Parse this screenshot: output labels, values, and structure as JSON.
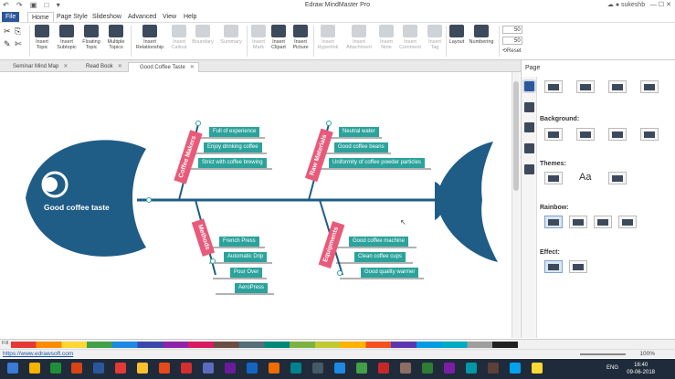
{
  "window": {
    "title": "Edraw MindMaster Pro",
    "user": "sukeshb",
    "quick_access": "↶ ↷ ▣ □ ▾"
  },
  "menu": {
    "file": "File",
    "items": [
      "Home",
      "Page Style",
      "Slideshow",
      "Advanced",
      "View",
      "Help"
    ]
  },
  "ribbon": {
    "buttons": [
      {
        "label": "Insert Topic",
        "enabled": true
      },
      {
        "label": "Insert Subtopic",
        "enabled": true
      },
      {
        "label": "Floating Topic",
        "enabled": true
      },
      {
        "label": "Multiple Topics",
        "enabled": true
      },
      {
        "label": "Insert Relationship",
        "enabled": true
      },
      {
        "label": "Insert Callout",
        "enabled": false
      },
      {
        "label": "Boundary",
        "enabled": false
      },
      {
        "label": "Summary",
        "enabled": false
      },
      {
        "label": "Insert Mark",
        "enabled": false
      },
      {
        "label": "Insert Clipart",
        "enabled": true
      },
      {
        "label": "Insert Picture",
        "enabled": true
      },
      {
        "label": "Insert Hyperlink",
        "enabled": false
      },
      {
        "label": "Insert Attachment",
        "enabled": false
      },
      {
        "label": "Insert Note",
        "enabled": false
      },
      {
        "label": "Insert Comment",
        "enabled": false
      },
      {
        "label": "Insert Tag",
        "enabled": false
      },
      {
        "label": "Layout",
        "enabled": true
      },
      {
        "label": "Numbering",
        "enabled": true
      }
    ],
    "spin1": "50",
    "spin2": "50",
    "reset": "Reset"
  },
  "tabs": [
    {
      "label": "Seminar Mind Map",
      "active": false
    },
    {
      "label": "Read Book",
      "active": false
    },
    {
      "label": "Good Coffee Taste",
      "active": true
    }
  ],
  "mindmap": {
    "central": "Good coffee taste",
    "colors": {
      "fish": "#1f5c86",
      "main": "#e85a7a",
      "sub": "#2ba39c"
    },
    "branches": [
      {
        "name": "Coffee Makers",
        "items": [
          "Full of experience",
          "Enjoy drinking coffee",
          "Strict with coffee brewing"
        ]
      },
      {
        "name": "Raw Materials",
        "items": [
          "Neutral water",
          "Good coffee beans",
          "Uniformity of coffee powder particles"
        ]
      },
      {
        "name": "Methods",
        "items": [
          "French Press",
          "Automatic Drip",
          "Pour Over",
          "AeroPress"
        ]
      },
      {
        "name": "Equipments",
        "items": [
          "Good coffee machine",
          "Clean coffee cups",
          "Good quality warmer"
        ]
      }
    ]
  },
  "panel": {
    "title": "Page",
    "background": "Background:",
    "themes": "Themes:",
    "rainbow": "Rainbow:",
    "effect": "Effect:",
    "font_sample": "Aa"
  },
  "status": {
    "url": "https://www.edrawsoft.com",
    "fill_label": "Fill",
    "zoom": "100%"
  },
  "taskbar": {
    "lang": "ENG",
    "time": "16:40",
    "date": "09-06-2018"
  }
}
